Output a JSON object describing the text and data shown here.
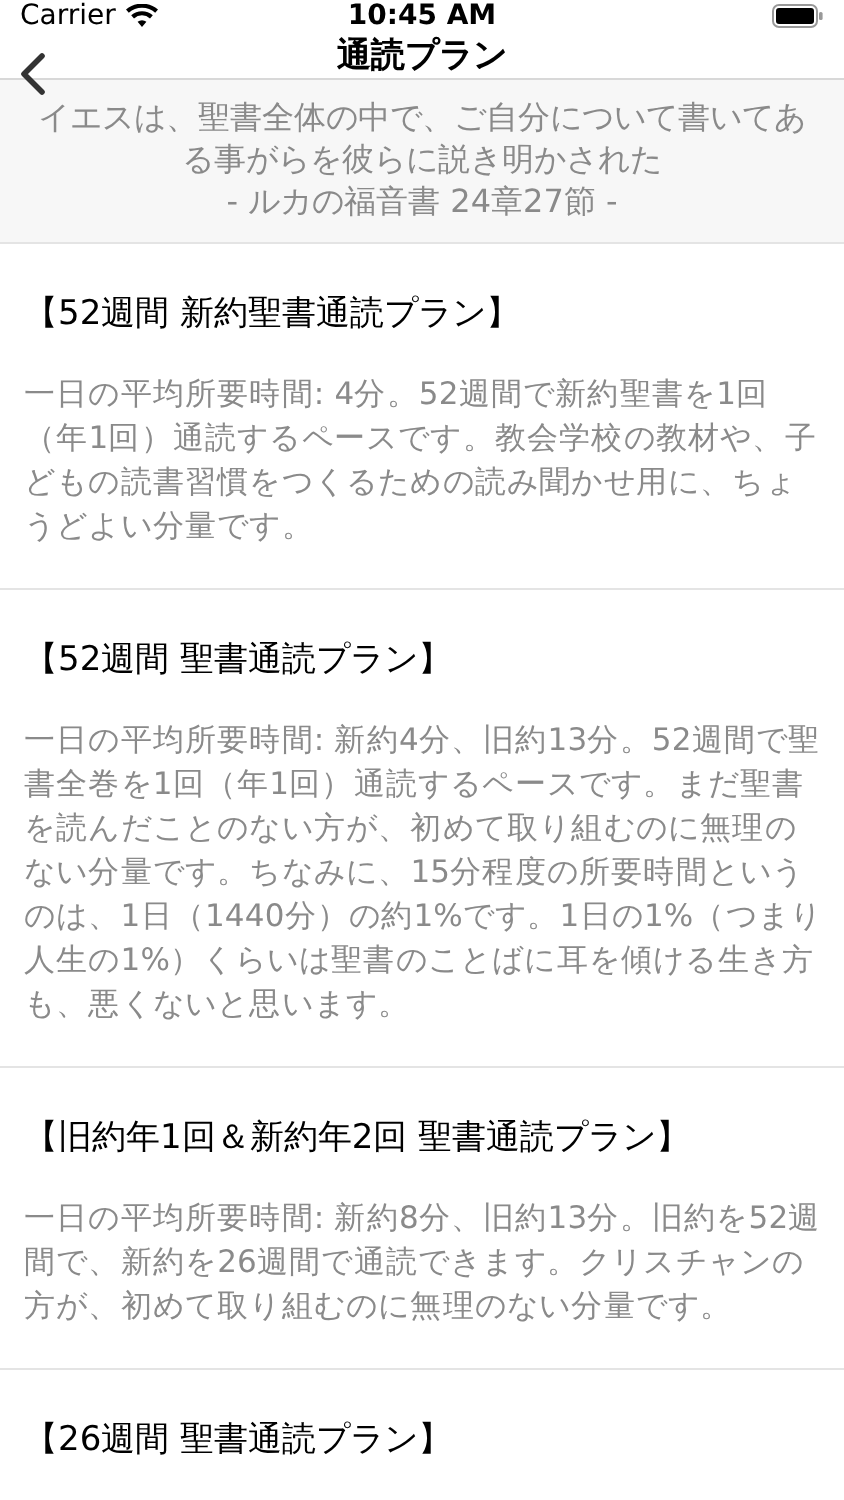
{
  "status_bar": {
    "carrier": "Carrier",
    "time": "10:45 AM"
  },
  "nav": {
    "title": "通読プラン"
  },
  "quote": {
    "text": "イエスは、聖書全体の中で、ご自分について書いてある事がらを彼らに説き明かされた",
    "source": "- ルカの福音書 24章27節 -"
  },
  "plans": [
    {
      "title": "【52週間 新約聖書通読プラン】",
      "description": "一日の平均所要時間: 4分。52週間で新約聖書を1回（年1回）通読するペースです。教会学校の教材や、子どもの読書習慣をつくるための読み聞かせ用に、ちょうどよい分量です。"
    },
    {
      "title": "【52週間 聖書通読プラン】",
      "description": "一日の平均所要時間: 新約4分、旧約13分。52週間で聖書全巻を1回（年1回）通読するペースです。まだ聖書を読んだことのない方が、初めて取り組むのに無理のない分量です。ちなみに、15分程度の所要時間というのは、1日（1440分）の約1%です。1日の1%（つまり人生の1%）くらいは聖書のことばに耳を傾ける生き方も、悪くないと思います。"
    },
    {
      "title": "【旧約年1回＆新約年2回 聖書通読プラン】",
      "description": "一日の平均所要時間: 新約8分、旧約13分。旧約を52週間で、新約を26週間で通読できます。クリスチャンの方が、初めて取り組むのに無理のない分量です。"
    },
    {
      "title": "【26週間 聖書通読プラン】"
    }
  ]
}
